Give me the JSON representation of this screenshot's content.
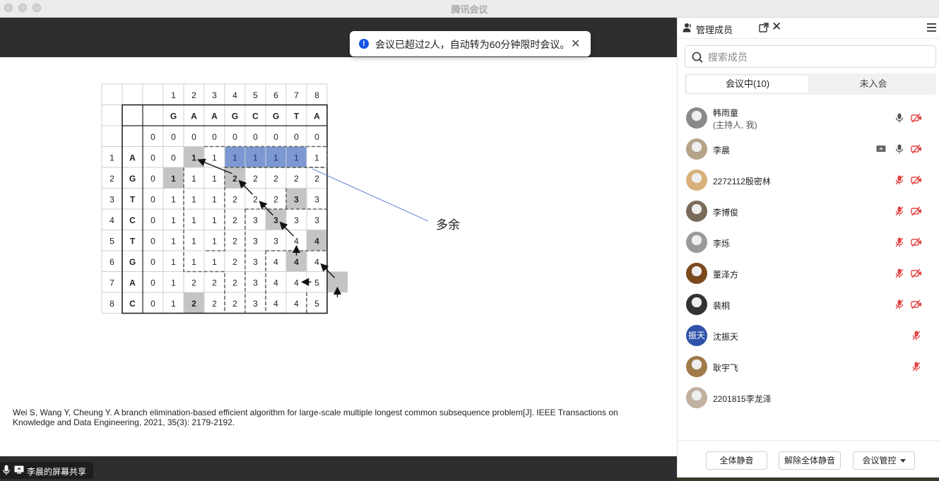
{
  "window": {
    "title": "腾讯会议"
  },
  "toast": {
    "text": "会议已超过2人，自动转为60分钟限时会议。"
  },
  "share_status": {
    "text": "李晨的屏幕共享"
  },
  "slide": {
    "annotation": "多余",
    "citation": "Wei S, Wang Y, Cheung Y. A branch elimination-based efficient algorithm for large-scale multiple longest common subsequence problem[J]. IEEE Transactions on Knowledge and Data Engineering, 2021, 35(3): 2179-2192.",
    "col_numbers": [
      "1",
      "2",
      "3",
      "4",
      "5",
      "6",
      "7",
      "8"
    ],
    "col_letters": [
      "G",
      "A",
      "A",
      "G",
      "C",
      "G",
      "T",
      "A"
    ],
    "row_numbers": [
      "1",
      "2",
      "3",
      "4",
      "5",
      "6",
      "7",
      "8"
    ],
    "row_letters": [
      "A",
      "G",
      "T",
      "C",
      "T",
      "G",
      "A",
      "C"
    ],
    "matrix": [
      [
        "0",
        "0",
        "0",
        "0",
        "0",
        "0",
        "0",
        "0",
        "0"
      ],
      [
        "0",
        "0",
        "1",
        "1",
        "1",
        "1",
        "1",
        "1",
        "1"
      ],
      [
        "0",
        "1",
        "1",
        "1",
        "2",
        "2",
        "2",
        "2",
        "2"
      ],
      [
        "0",
        "1",
        "1",
        "1",
        "2",
        "2",
        "2",
        "3",
        "3"
      ],
      [
        "0",
        "1",
        "1",
        "1",
        "2",
        "3",
        "3",
        "3",
        "3"
      ],
      [
        "0",
        "1",
        "1",
        "1",
        "2",
        "3",
        "3",
        "4",
        "4"
      ],
      [
        "0",
        "1",
        "1",
        "1",
        "2",
        "3",
        "4",
        "4",
        "4"
      ],
      [
        "0",
        "1",
        "2",
        "2",
        "2",
        "3",
        "4",
        "4",
        "5"
      ],
      [
        "0",
        "1",
        "2",
        "2",
        "2",
        "3",
        "4",
        "4",
        "5"
      ]
    ]
  },
  "panel": {
    "title": "管理成员",
    "search_placeholder": "搜索成员",
    "tabs": [
      {
        "label": "会议中(10)",
        "active": true
      },
      {
        "label": "未入会",
        "active": false
      }
    ],
    "members": [
      {
        "name": "韩雨童",
        "role": "(主持人, 我)",
        "screen": false,
        "mic": "on",
        "camera": "off"
      },
      {
        "name": "李晨",
        "role": "",
        "screen": true,
        "mic": "on",
        "camera": "off"
      },
      {
        "name": "2272112殷密林",
        "role": "",
        "screen": false,
        "mic": "muted",
        "camera": "off"
      },
      {
        "name": "李博俊",
        "role": "",
        "screen": false,
        "mic": "muted",
        "camera": "off"
      },
      {
        "name": "李烁",
        "role": "",
        "screen": false,
        "mic": "muted",
        "camera": "off"
      },
      {
        "name": "董泽方",
        "role": "",
        "screen": false,
        "mic": "muted",
        "camera": "off"
      },
      {
        "name": "裴桐",
        "role": "",
        "screen": false,
        "mic": "muted",
        "camera": "off"
      },
      {
        "name": "沈振天",
        "role": "",
        "avatar_text": "振天",
        "screen": false,
        "mic": "muted",
        "camera": "none"
      },
      {
        "name": "耿宇飞",
        "role": "",
        "screen": false,
        "mic": "muted",
        "camera": "none"
      },
      {
        "name": "2201815李龙泽",
        "role": "",
        "screen": false,
        "mic": "none",
        "camera": "none"
      }
    ],
    "footer": {
      "mute_all": "全体静音",
      "unmute_all": "解除全体静音",
      "control": "会议管控"
    }
  },
  "colors": {
    "accent": "#1552e6",
    "highlight_blue": "#7b98d2",
    "cell_gray": "#c8c8c8",
    "muted_red": "#e24545"
  }
}
